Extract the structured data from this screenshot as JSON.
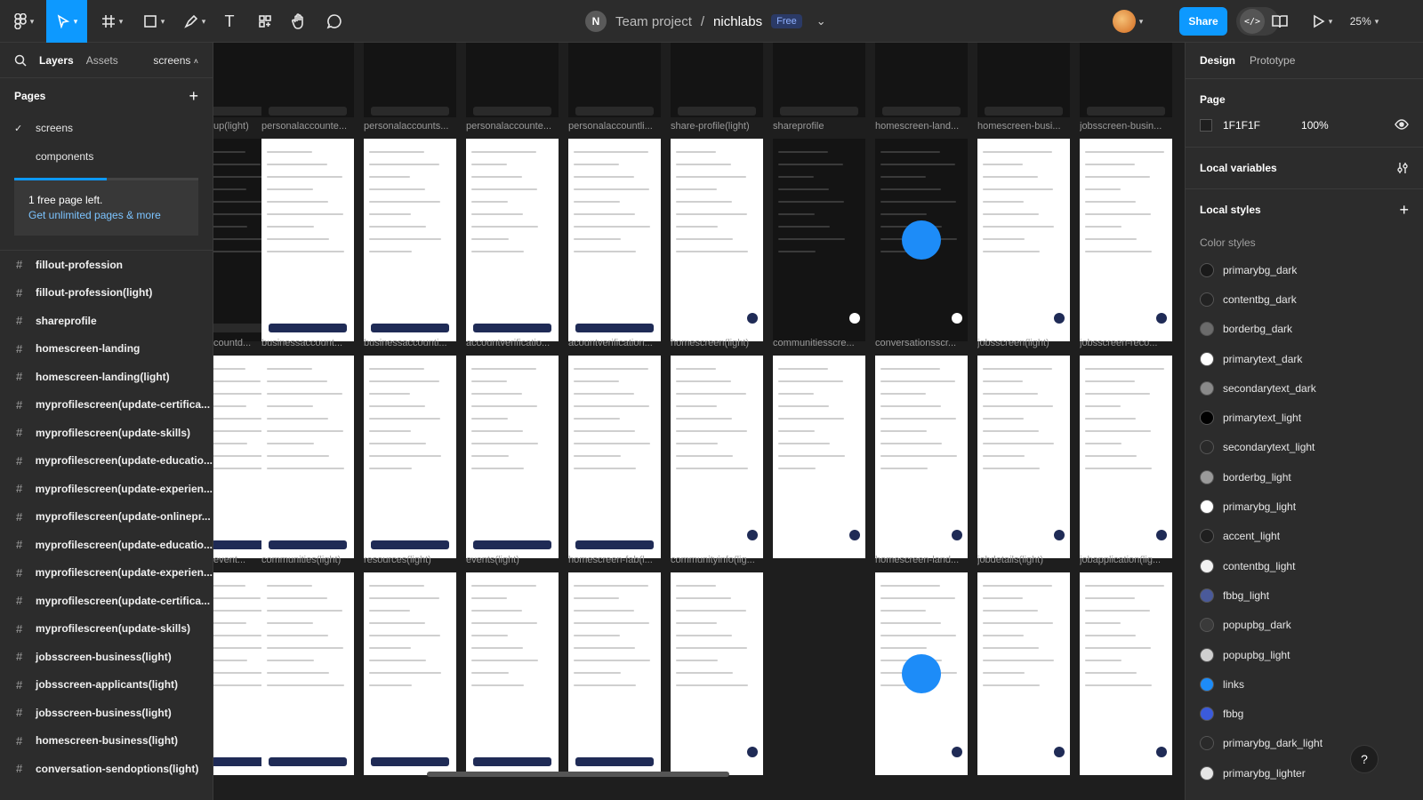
{
  "toolbar": {
    "main_menu_icon": "figma-logo-icon",
    "move_tool": "move-cursor-icon",
    "frame_tool": "frame-hash-icon",
    "shape_tool": "rectangle-icon",
    "pen_tool": "pen-icon",
    "text_tool_glyph": "T",
    "components_tool": "components-icon",
    "hand_tool": "hand-icon",
    "comment_tool": "comment-bubble-icon"
  },
  "title": {
    "avatar_initial": "N",
    "team": "Team project",
    "separator": "/",
    "file": "nichlabs",
    "plan_badge": "Free",
    "chevron": "⌄"
  },
  "header_right": {
    "share_label": "Share",
    "dev_mode_glyph": "</>",
    "zoom": "25%"
  },
  "left_panel": {
    "tabs": [
      "Layers",
      "Assets"
    ],
    "current_page": "screens",
    "pages_title": "Pages",
    "pages": [
      {
        "name": "screens",
        "selected": true
      },
      {
        "name": "components",
        "selected": false
      }
    ],
    "plan_progress": 0.5,
    "upsell_text": "1 free page left.",
    "upsell_link": "Get unlimited pages & more",
    "layers": [
      "fillout-profession",
      "fillout-profession(light)",
      "shareprofile",
      "homescreen-landing",
      "homescreen-landing(light)",
      "myprofilescreen(update-certifica...",
      "myprofilescreen(update-skills)",
      "myprofilescreen(update-educatio...",
      "myprofilescreen(update-experien...",
      "myprofilescreen(update-onlinepr...",
      "myprofilescreen(update-educatio...",
      "myprofilescreen(update-experien...",
      "myprofilescreen(update-certifica...",
      "myprofilescreen(update-skills)",
      "jobsscreen-business(light)",
      "jobsscreen-applicants(light)",
      "jobsscreen-business(light)",
      "homescreen-business(light)",
      "conversation-sendoptions(light)"
    ]
  },
  "canvas": {
    "row1_labels": [
      "up(light)",
      "personalaccounte...",
      "personalaccounts...",
      "personalaccounte...",
      "personalaccountli...",
      "share-profile(light)",
      "shareprofile",
      "homescreen-land...",
      "homescreen-busi...",
      "jobsscreen-busin..."
    ],
    "row2_labels": [
      "countd...",
      "businessaccount...",
      "businessaccounti...",
      "accountverificatio...",
      "acountverification...",
      "homescreen(light)",
      "communitiesscre...",
      "conversationsscr...",
      "jobsscreen(light)",
      "jobsscreen-reco..."
    ],
    "row3_labels": [
      "event...",
      "communities(light)",
      "resources(light)",
      "events(light)",
      "homescreen-fab(l...",
      "communityinfo(lig...",
      "",
      "homescreen-land...",
      "jobdetails(light)",
      "jobapplication(lig..."
    ]
  },
  "right_panel": {
    "tabs": [
      "Design",
      "Prototype"
    ],
    "page_title": "Page",
    "page_color": "1F1F1F",
    "page_opacity": "100%",
    "local_variables": "Local variables",
    "local_styles": "Local styles",
    "color_styles_title": "Color styles",
    "color_styles": [
      {
        "name": "primarybg_dark",
        "color": "#1a1a1a"
      },
      {
        "name": "contentbg_dark",
        "color": "#222222"
      },
      {
        "name": "borderbg_dark",
        "color": "#6b6b6b"
      },
      {
        "name": "primarytext_dark",
        "color": "#ffffff"
      },
      {
        "name": "secondarytext_dark",
        "color": "#8a8a8a"
      },
      {
        "name": "primarytext_light",
        "color": "#000000"
      },
      {
        "name": "secondarytext_light",
        "color": "#2a2a2a"
      },
      {
        "name": "borderbg_light",
        "color": "#9a9a9a"
      },
      {
        "name": "primarybg_light",
        "color": "#ffffff"
      },
      {
        "name": "accent_light",
        "color": "#1f1f1f"
      },
      {
        "name": "contentbg_light",
        "color": "#f2f2f2"
      },
      {
        "name": "fbbg_light",
        "color": "#4a5a9a"
      },
      {
        "name": "popupbg_dark",
        "color": "#3a3a3a"
      },
      {
        "name": "popupbg_light",
        "color": "#cfcfcf"
      },
      {
        "name": "links",
        "color": "#1d8cf8"
      },
      {
        "name": "fbbg",
        "color": "#3b5bdb"
      },
      {
        "name": "primarybg_dark_light",
        "color": "#2a2a2a"
      },
      {
        "name": "primarybg_lighter",
        "color": "#e6e6e6"
      }
    ],
    "help_glyph": "?"
  },
  "colors": {
    "accent": "#0d99ff",
    "chrome": "#2c2c2c",
    "canvas": "#1e1e1e"
  }
}
